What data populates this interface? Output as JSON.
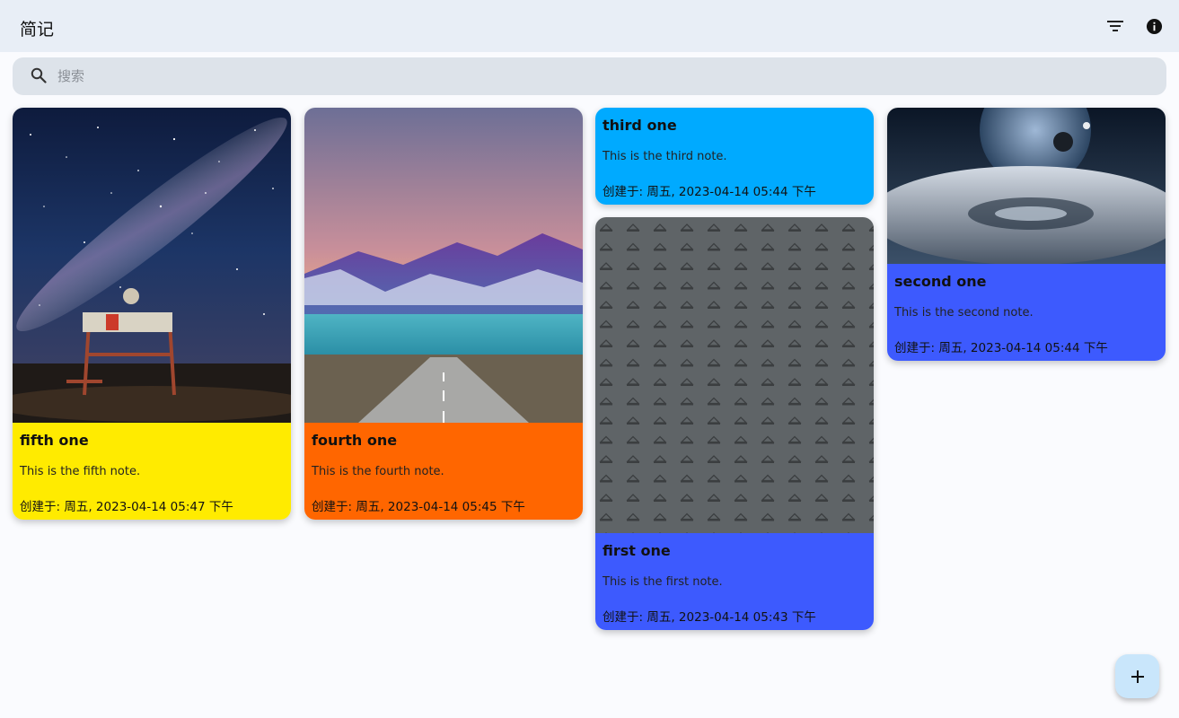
{
  "app": {
    "title": "简记"
  },
  "toolbar": {
    "filter_icon": "filter-list-icon",
    "info_icon": "info-icon"
  },
  "search": {
    "placeholder": "搜索",
    "value": "",
    "icon": "search-icon"
  },
  "notes": [
    {
      "title": "fifth one",
      "text": "This is the fifth note.",
      "date": "创建于: 周五, 2023-04-14 05:47 下午",
      "color": "#FFEB00",
      "image": "starry-night-lifeguard-tower"
    },
    {
      "title": "fourth one",
      "text": "This is the fourth note.",
      "date": "创建于: 周五, 2023-04-14 05:45 下午",
      "color": "#FF6600",
      "image": "mountain-road"
    },
    {
      "title": "third one",
      "text": "This is the third note.",
      "date": "创建于: 周五, 2023-04-14 05:44 下午",
      "color": "#00AAFF"
    },
    {
      "title": "first one",
      "text": "This is the first note.",
      "date": "创建于: 周五, 2023-04-14 05:43 下午",
      "color": "#3D5AFE",
      "image": "gray-pattern-texture"
    },
    {
      "title": "second one",
      "text": "This is the second note.",
      "date": "创建于: 周五, 2023-04-14 05:44 下午",
      "color": "#3D5AFE",
      "image": "planet-over-clouds"
    }
  ],
  "fab": {
    "label": "+",
    "icon": "add-icon"
  }
}
